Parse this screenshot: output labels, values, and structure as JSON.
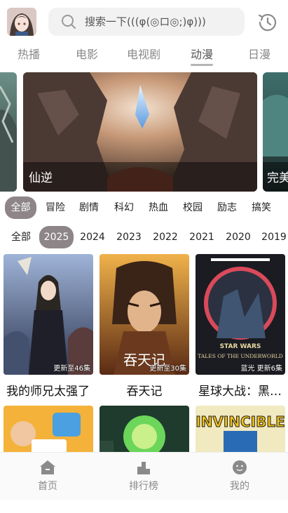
{
  "search": {
    "placeholder": "搜索一下(((φ(◎ロ◎;)φ)))"
  },
  "tabs": [
    {
      "label": "热播",
      "active": false
    },
    {
      "label": "电影",
      "active": false
    },
    {
      "label": "电视剧",
      "active": false
    },
    {
      "label": "动漫",
      "active": true
    },
    {
      "label": "日漫",
      "active": false
    }
  ],
  "banners": [
    {
      "title": ""
    },
    {
      "title": "仙逆"
    },
    {
      "title": "完美"
    }
  ],
  "genres": {
    "selected": "全部",
    "items": [
      "全部",
      "冒险",
      "剧情",
      "科幻",
      "热血",
      "校园",
      "励志",
      "搞笑"
    ]
  },
  "years": {
    "selected": "2025",
    "items": [
      "全部",
      "2025",
      "2024",
      "2023",
      "2022",
      "2021",
      "2020",
      "2019"
    ]
  },
  "cards": [
    {
      "title": "我的师兄太强了",
      "episodes": "更新至46集",
      "poster_label": ""
    },
    {
      "title": "吞天记",
      "episodes": "更新至30集",
      "poster_label": "吞天记"
    },
    {
      "title": "星球大战：黑…",
      "episodes": "蓝光 更新6集",
      "poster_label": "TALES OF THE UNDERWORLD",
      "poster_brand": "STAR WARS"
    }
  ],
  "row2_cards": [
    {
      "poster_label": ""
    },
    {
      "poster_label": ""
    },
    {
      "poster_label": "INVINCIBLE"
    }
  ],
  "bottom_nav": [
    {
      "label": "首页",
      "icon": "home-icon"
    },
    {
      "label": "排行榜",
      "icon": "ranking-icon"
    },
    {
      "label": "我的",
      "icon": "profile-icon"
    }
  ],
  "colors": {
    "chip_active": "#8d8587",
    "tab_underline": "#b5b5b5"
  }
}
